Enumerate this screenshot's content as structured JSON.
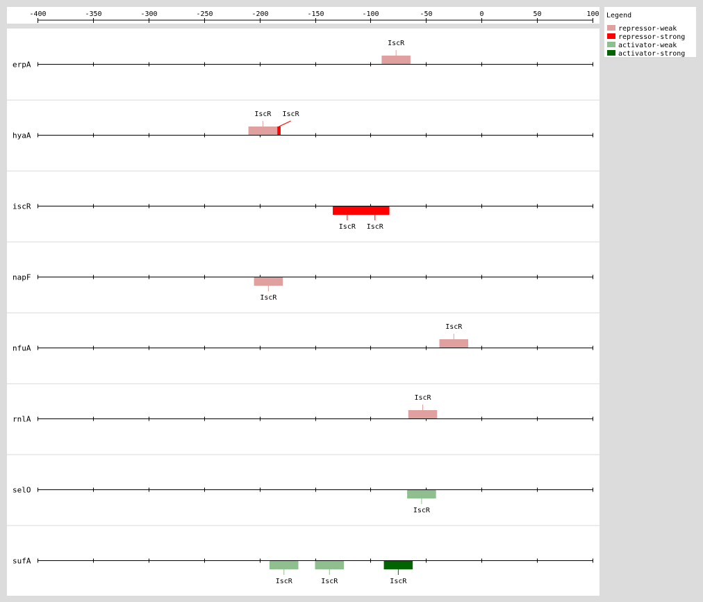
{
  "axis": {
    "min": -400,
    "max": 100,
    "ticks": [
      "-400",
      "-350",
      "-300",
      "-250",
      "-200",
      "-150",
      "-100",
      "-50",
      "0",
      "50",
      "100"
    ]
  },
  "legend": {
    "title": "Legend",
    "items": [
      {
        "label": "repressor-weak",
        "color": "#e0a0a0"
      },
      {
        "label": "repressor-strong",
        "color": "#ff0000"
      },
      {
        "label": "activator-weak",
        "color": "#8fbf8f"
      },
      {
        "label": "activator-strong",
        "color": "#006400"
      }
    ]
  },
  "genes": [
    {
      "name": "erpA",
      "sites": [
        {
          "label": "IscR",
          "start": -90,
          "end": -64,
          "type": "repressor-weak",
          "side": "above"
        }
      ]
    },
    {
      "name": "hyaA",
      "sites": [
        {
          "label": "IscR",
          "start": -210,
          "end": -184,
          "type": "repressor-weak",
          "side": "above"
        },
        {
          "label": "IscR",
          "start": -184,
          "end": -181,
          "type": "repressor-strong",
          "side": "above",
          "offset_label": true
        }
      ]
    },
    {
      "name": "iscR",
      "sites": [
        {
          "label": "IscR",
          "start": -134,
          "end": -108,
          "type": "repressor-strong",
          "side": "below"
        },
        {
          "label": "IscR",
          "start": -109,
          "end": -83,
          "type": "repressor-strong",
          "side": "below"
        }
      ]
    },
    {
      "name": "napF",
      "sites": [
        {
          "label": "IscR",
          "start": -205,
          "end": -179,
          "type": "repressor-weak",
          "side": "below"
        }
      ]
    },
    {
      "name": "nfuA",
      "sites": [
        {
          "label": "IscR",
          "start": -38,
          "end": -12,
          "type": "repressor-weak",
          "side": "above"
        }
      ]
    },
    {
      "name": "rnlA",
      "sites": [
        {
          "label": "IscR",
          "start": -66,
          "end": -40,
          "type": "repressor-weak",
          "side": "above"
        }
      ]
    },
    {
      "name": "selO",
      "sites": [
        {
          "label": "IscR",
          "start": -67,
          "end": -41,
          "type": "activator-weak",
          "side": "below"
        }
      ]
    },
    {
      "name": "sufA",
      "sites": [
        {
          "label": "IscR",
          "start": -191,
          "end": -165,
          "type": "activator-weak",
          "side": "below"
        },
        {
          "label": "IscR",
          "start": -150,
          "end": -124,
          "type": "activator-weak",
          "side": "below"
        },
        {
          "label": "IscR",
          "start": -88,
          "end": -62,
          "type": "activator-strong",
          "side": "below"
        }
      ]
    }
  ]
}
